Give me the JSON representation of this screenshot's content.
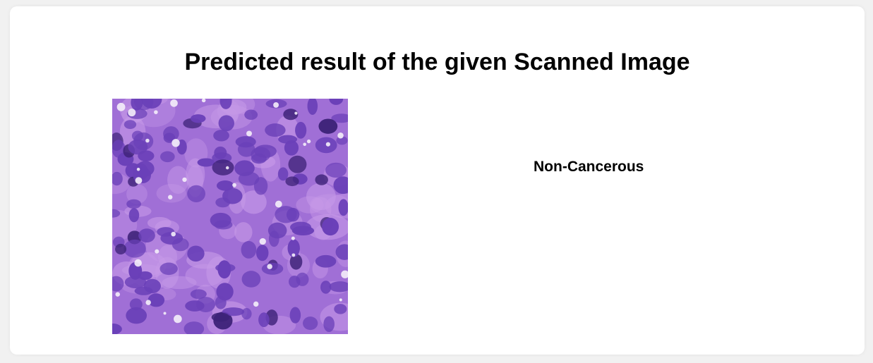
{
  "page": {
    "title": "Predicted result of the given Scanned Image"
  },
  "result": {
    "label": "Non-Cancerous"
  },
  "scan_image": {
    "icon": "histology-scan-image",
    "colors": {
      "tissue": "#a06fd6",
      "tissue_light": "#c79ae8",
      "nucleus": "#6a40b8",
      "nucleus_dark": "#3d2278",
      "vacuole": "#f4eefa"
    }
  }
}
